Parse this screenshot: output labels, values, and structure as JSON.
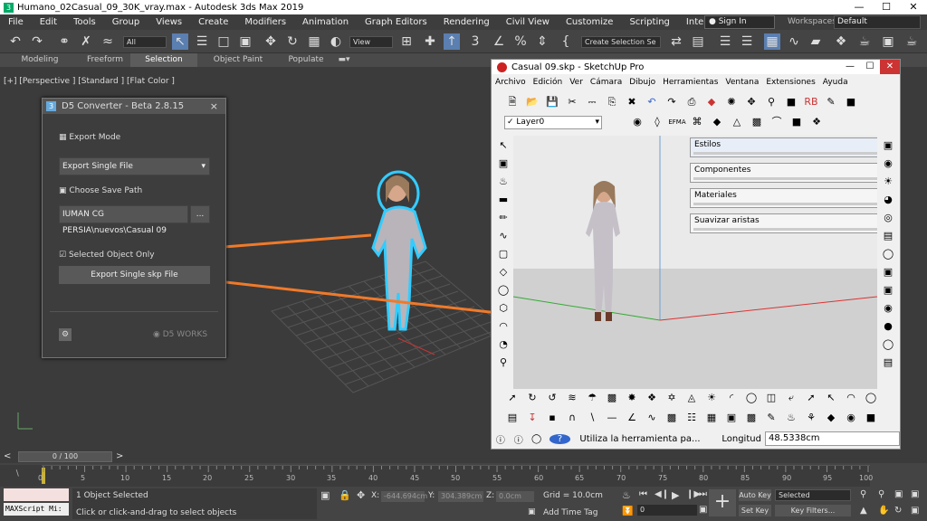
{
  "window": {
    "title": "Humano_02Casual_09_30K_vray.max - Autodesk 3ds Max 2019",
    "icon": "3"
  },
  "menu": [
    "File",
    "Edit",
    "Tools",
    "Group",
    "Views",
    "Create",
    "Modifiers",
    "Animation",
    "Graph Editors",
    "Rendering",
    "Civil View",
    "Customize",
    "Scripting",
    "Interactive"
  ],
  "sign_in": "Sign In",
  "workspaces_label": "Workspaces:",
  "workspaces_value": "Default",
  "toolbar": {
    "filter": "All",
    "view": "View",
    "selection_set": "Create Selection Se"
  },
  "ribbon_tabs": [
    {
      "label": "Modeling",
      "selected": false
    },
    {
      "label": "Freeform",
      "selected": false
    },
    {
      "label": "Selection",
      "selected": true
    },
    {
      "label": "Object Paint",
      "selected": false
    },
    {
      "label": "Populate",
      "selected": false
    }
  ],
  "viewport_label": "[+] [Perspective ] [Standard ] [Flat Color ]",
  "d5": {
    "title": "D5 Converter - Beta 2.8.15",
    "close": "×",
    "export_mode_label": "Export Mode",
    "export_mode_value": "Export Single File",
    "choose_path_label": "Choose Save Path",
    "path_value": "IUMAN CG PERSIA\\nuevos\\Casual 09",
    "browse": "...",
    "selected_only_label": "Selected Object Only",
    "selected_only_checked": true,
    "export_button": "Export Single skp File",
    "brand": "D5 WORKS"
  },
  "sketchup": {
    "title": "Casual 09.skp - SketchUp Pro",
    "menu": [
      "Archivo",
      "Edición",
      "Ver",
      "Cámara",
      "Dibujo",
      "Herramientas",
      "Ventana",
      "Extensiones",
      "Ayuda"
    ],
    "layer": "Layer0",
    "panels": [
      "Estilos",
      "Componentes",
      "Materiales",
      "Suavizar aristas"
    ],
    "status_text": "Utiliza la herramienta pa...",
    "length_label": "Longitud",
    "length_value": "48.5338cm"
  },
  "timeline": {
    "frame": "0 / 100",
    "ticks": [
      "0",
      "5",
      "10",
      "15",
      "20",
      "25",
      "30",
      "35",
      "40",
      "45",
      "50",
      "55",
      "60",
      "65",
      "70",
      "75",
      "80",
      "85",
      "90",
      "95",
      "100"
    ]
  },
  "status": {
    "maxscript": "MAXScript Mi:",
    "selected": "1 Object Selected",
    "hint": "Click or click-and-drag to select objects",
    "x": "-644.694cm",
    "y": "304.389cm",
    "z": "0.0cm",
    "x_label": "X:",
    "y_label": "Y:",
    "z_label": "Z:",
    "grid": "Grid = 10.0cm",
    "add_time_tag": "Add Time Tag",
    "auto_key": "Auto Key",
    "set_key": "Set Key",
    "selected_dd": "Selected",
    "key_filters": "Key Filters...",
    "frame_box": "0"
  },
  "colors": {
    "arrow": "#f07a2a",
    "accent_blue": "#3a7bd5"
  }
}
